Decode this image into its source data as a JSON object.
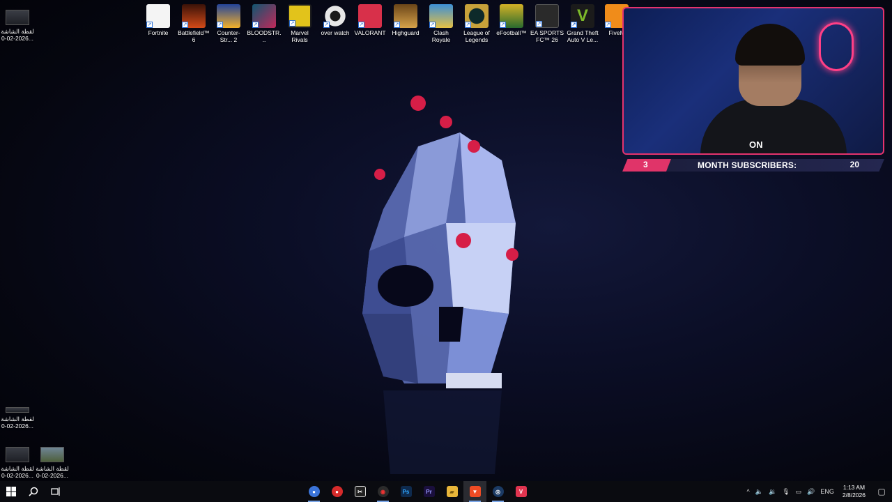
{
  "desktop": {
    "top_icons": [
      {
        "label": "Fortnite",
        "color": "#f4f4f4",
        "icon": "fortnite-icon"
      },
      {
        "label": "Battlefield™ 6",
        "color": "#d24a18",
        "icon": "battlefield-icon"
      },
      {
        "label": "Counter-Str... 2",
        "color": "#3a61b5",
        "icon": "counter-strike-icon"
      },
      {
        "label": "BLOODSTR...",
        "color": "#1f8ea6",
        "icon": "bloodstrike-icon"
      },
      {
        "label": "Marvel Rivals",
        "color": "#e2c31b",
        "icon": "marvel-rivals-icon"
      },
      {
        "label": "over watch",
        "color": "#e7e7e7",
        "icon": "overwatch-icon"
      },
      {
        "label": "VALORANT",
        "color": "#d8304a",
        "icon": "valorant-icon"
      },
      {
        "label": "Highguard",
        "color": "#b07a30",
        "icon": "highguard-icon"
      },
      {
        "label": "Clash Royale",
        "color": "#3c8fd6",
        "icon": "clash-royale-icon"
      },
      {
        "label": "League of Legends",
        "color": "#c8a23a",
        "icon": "league-of-legends-icon"
      },
      {
        "label": "eFootball™",
        "color": "#d3b126",
        "icon": "efootball-icon"
      },
      {
        "label": "EA SPORTS FC™ 26",
        "color": "#2a2a2a",
        "icon": "ea-fc-icon"
      },
      {
        "label": "Grand Theft Auto V Le...",
        "color": "#6c8f2a",
        "icon": "gta-icon"
      },
      {
        "label": "FiveM",
        "color": "#f08c1a",
        "icon": "fivem-icon"
      }
    ],
    "side_icons": [
      {
        "label": "لقطة الشاشة 2026-02-0..."
      },
      {
        "label": "لقطة الشاشة 2026-02-0..."
      },
      {
        "label": "لقطة الشاشة 2026-02-0..."
      },
      {
        "label": "لقطة الشاشة 2026-02-0..."
      }
    ]
  },
  "overlay": {
    "cam_tag": "ON",
    "sub_left": "3",
    "sub_label": "MONTH SUBSCRIBERS:",
    "sub_right": "20",
    "accent": "#e03469"
  },
  "taskbar": {
    "apps": [
      {
        "icon": "chrome-icon",
        "glyph": "●",
        "color": "#3b74d9"
      },
      {
        "icon": "red-app-icon",
        "glyph": "●",
        "color": "#d62b2b"
      },
      {
        "icon": "capcut-icon",
        "glyph": "✂",
        "color": "#222"
      },
      {
        "icon": "red-circle-app-icon",
        "glyph": "◉",
        "color": "#2b2b2b"
      },
      {
        "icon": "photoshop-icon",
        "glyph": "Ps",
        "color": "#0e2a4d"
      },
      {
        "icon": "premiere-icon",
        "glyph": "Pr",
        "color": "#1a0f3d"
      },
      {
        "icon": "file-explorer-icon",
        "glyph": "▰",
        "color": "#e8b63a"
      },
      {
        "icon": "brave-icon",
        "glyph": "▼",
        "color": "#ef4b24"
      },
      {
        "icon": "steam-icon",
        "glyph": "◎",
        "color": "#1b3a63"
      },
      {
        "icon": "valorant-taskbar-icon",
        "glyph": "V",
        "color": "#e0344f"
      }
    ],
    "tray": {
      "lang": "ENG",
      "time": "1:13 AM",
      "date": "2/8/2026"
    }
  }
}
